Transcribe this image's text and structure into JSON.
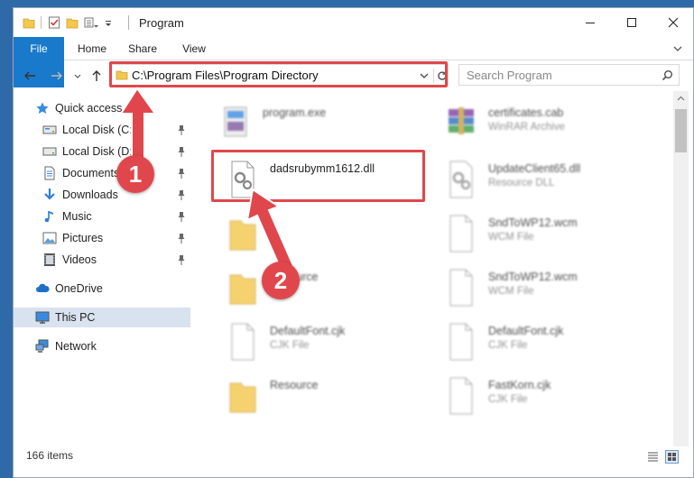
{
  "window": {
    "title": "Program"
  },
  "ribbon": {
    "tabs": [
      "File",
      "Home",
      "Share",
      "View"
    ]
  },
  "address": {
    "path": "C:\\Program Files\\Program Directory"
  },
  "search": {
    "placeholder": "Search Program"
  },
  "sidebar": {
    "items": [
      {
        "label": "Quick access",
        "icon": "star-icon"
      },
      {
        "label": "Local Disk (C:)",
        "icon": "drive-icon",
        "pinned": true
      },
      {
        "label": "Local Disk (D:)",
        "icon": "drive-icon",
        "pinned": true
      },
      {
        "label": "Documents",
        "icon": "document-icon",
        "pinned": true
      },
      {
        "label": "Downloads",
        "icon": "download-arrow-icon",
        "pinned": true
      },
      {
        "label": "Music",
        "icon": "music-note-icon",
        "pinned": true
      },
      {
        "label": "Pictures",
        "icon": "picture-icon",
        "pinned": true
      },
      {
        "label": "Videos",
        "icon": "video-icon",
        "pinned": true
      },
      {
        "label": "OneDrive",
        "icon": "cloud-icon"
      },
      {
        "label": "This PC",
        "icon": "computer-icon",
        "selected": true
      },
      {
        "label": "Network",
        "icon": "network-icon"
      }
    ]
  },
  "files": [
    {
      "name": "program.exe",
      "type": ""
    },
    {
      "name": "certificates.cab",
      "type": "WinRAR Archive"
    },
    {
      "name": "dadsrubymm1612.dll",
      "type": ""
    },
    {
      "name": "UpdateClient65.dll",
      "type": "Resource DLL"
    },
    {
      "name": "",
      "type": ""
    },
    {
      "name": "SndToWP12.wcm",
      "type": "WCM File"
    },
    {
      "name": "Resource",
      "type": ""
    },
    {
      "name": "SndToWP12.wcm",
      "type": "WCM File"
    },
    {
      "name": "DefaultFont.cjk",
      "type": "CJK File"
    },
    {
      "name": "DefaultFont.cjk",
      "type": "CJK File"
    },
    {
      "name": "Resource",
      "type": ""
    },
    {
      "name": "FastKorn.cjk",
      "type": "CJK File"
    }
  ],
  "status": {
    "count": "166 items"
  },
  "annotations": {
    "step1": "1",
    "step2": "2"
  },
  "colors": {
    "accent": "#1979ca",
    "annotation": "#e0474c",
    "selected": "#d9e2ef"
  }
}
